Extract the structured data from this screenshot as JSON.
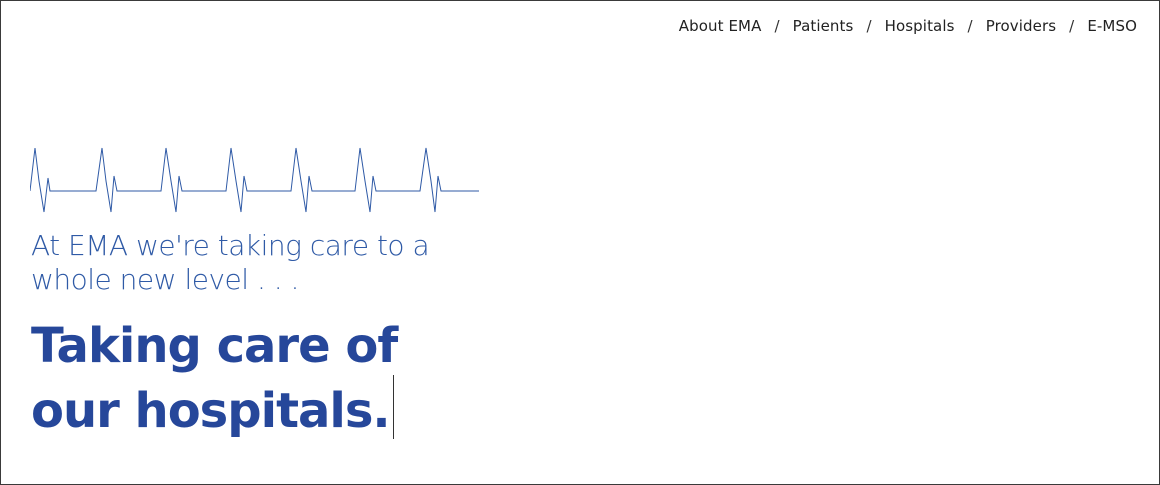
{
  "nav": {
    "items": [
      {
        "label": "About EMA"
      },
      {
        "label": "Patients"
      },
      {
        "label": "Hospitals"
      },
      {
        "label": "Providers"
      },
      {
        "label": "E-MSO"
      }
    ],
    "separator": "/"
  },
  "hero": {
    "tagline": "At EMA we're taking care to a whole new level . . .",
    "headline_line1": "Taking care of",
    "headline_line2": "our hospitals."
  },
  "colors": {
    "accent": "#2f5aa6",
    "headline": "#26479a",
    "nav_text": "#222222"
  },
  "icons": {
    "pulse": "ecg-heartbeat-line"
  }
}
